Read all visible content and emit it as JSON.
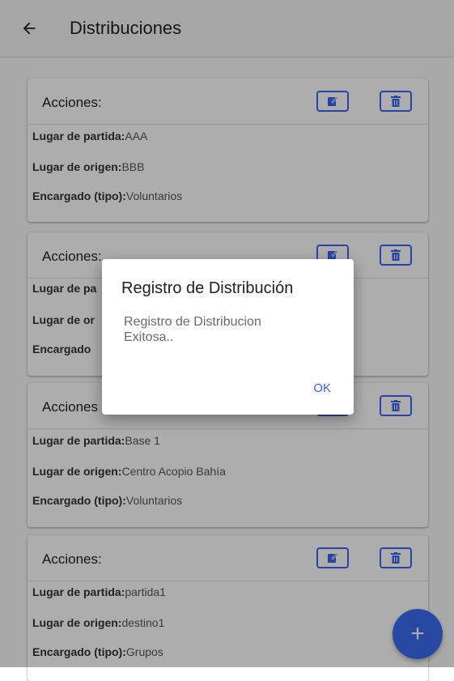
{
  "appbar": {
    "title": "Distribuciones"
  },
  "cards": [
    {
      "actions_label": "Acciones:",
      "partida_label": "Lugar de partida:",
      "partida_value": "AAA",
      "origen_label": "Lugar de origen:",
      "origen_value": "BBB",
      "encargado_label": "Encargado (tipo):",
      "encargado_value": "Voluntarios"
    },
    {
      "actions_label": "Acciones:",
      "partida_label": "Lugar de pa",
      "partida_value": "",
      "origen_label": "Lugar de or",
      "origen_value": "",
      "encargado_label": "Encargado",
      "encargado_value": ""
    },
    {
      "actions_label": "Acciones",
      "partida_label": "Lugar de partida:",
      "partida_value": "Base 1",
      "origen_label": "Lugar de origen:",
      "origen_value": "Centro Acopio Bahía",
      "encargado_label": "Encargado (tipo):",
      "encargado_value": "Voluntarios"
    },
    {
      "actions_label": "Acciones:",
      "partida_label": "Lugar de partida:",
      "partida_value": "partida1",
      "origen_label": "Lugar de origen:",
      "origen_value": "destino1",
      "encargado_label": "Encargado (tipo):",
      "encargado_value": "Grupos"
    }
  ],
  "dialog": {
    "title": "Registro de Distribución",
    "message": "Registro de Distribucion Exitosa..",
    "ok_label": "OK"
  },
  "fab": {
    "label": "+"
  },
  "colors": {
    "accent": "#3b63f3",
    "fab": "#3b6cf0"
  },
  "icons": {
    "back": "arrow-left-icon",
    "edit": "edit-icon",
    "delete": "trash-icon"
  }
}
